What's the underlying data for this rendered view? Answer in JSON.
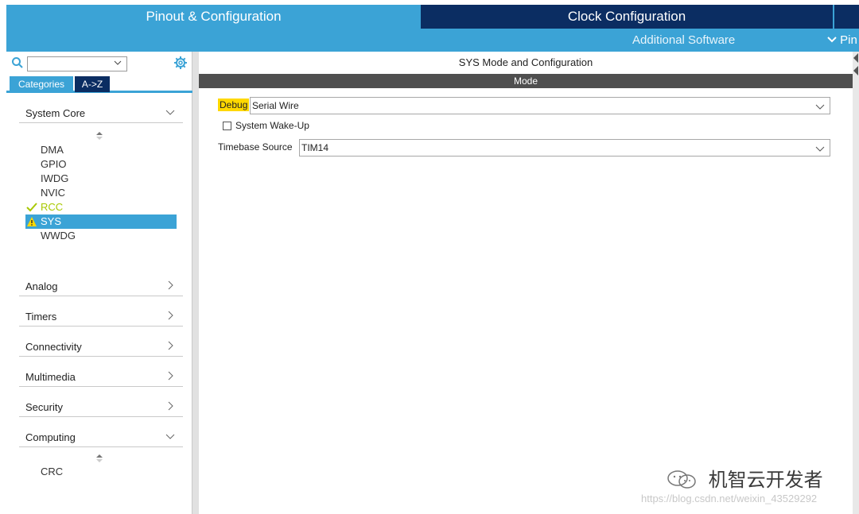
{
  "tabs": {
    "pinout": "Pinout & Configuration",
    "clock": "Clock Configuration"
  },
  "subbar": {
    "additional_software": "Additional Software",
    "pinout_menu": "Pin"
  },
  "left": {
    "category_tab": "Categories",
    "az_tab": "A->Z",
    "groups": {
      "system_core": "System Core",
      "analog": "Analog",
      "timers": "Timers",
      "connectivity": "Connectivity",
      "multimedia": "Multimedia",
      "security": "Security",
      "computing": "Computing"
    },
    "system_core_items": [
      "DMA",
      "GPIO",
      "IWDG",
      "NVIC",
      "RCC",
      "SYS",
      "WWDG"
    ],
    "computing_items": [
      "CRC"
    ]
  },
  "main": {
    "title": "SYS Mode and Configuration",
    "mode_header": "Mode",
    "debug_label": "Debug",
    "debug_value": "Serial Wire",
    "wakeup_label": "System Wake-Up",
    "timebase_label": "Timebase Source",
    "timebase_value": "TIM14"
  },
  "watermark": {
    "brand": "机智云开发者",
    "url": "https://blog.csdn.net/weixin_43529292"
  },
  "colors": {
    "accent_blue": "#3ba3d6",
    "dark_navy": "#0b2d62",
    "highlight_yellow": "#ffd800",
    "rcc_green": "#a8c800"
  }
}
